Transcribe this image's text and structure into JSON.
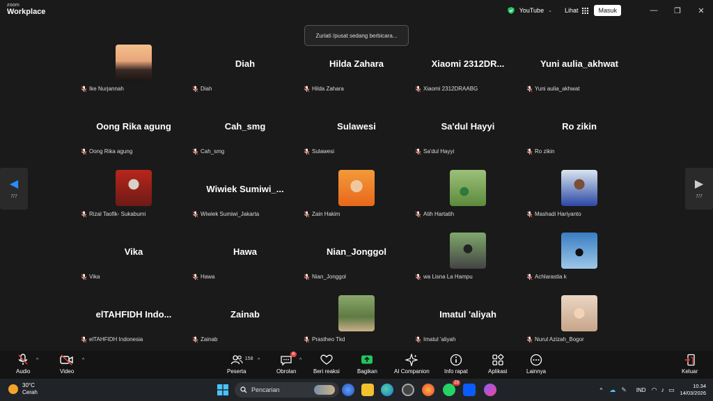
{
  "app": {
    "logo_top": "zoom",
    "logo_bottom": "Workplace"
  },
  "titlebar": {
    "youtube_label": "YouTube",
    "lihat": "Lihat",
    "masuk": "Masuk"
  },
  "toast": "Zuriati /pusat sedang berbicara...",
  "nav": {
    "page_left": "7/7",
    "page_right": "7/7"
  },
  "tiles": [
    {
      "bigname": "",
      "label": "Ike Nurjannah",
      "avatar": "sunset-silhouette"
    },
    {
      "bigname": "Diah",
      "label": "Diah"
    },
    {
      "bigname": "Hilda Zahara",
      "label": "Hilda Zahara"
    },
    {
      "bigname": "Xiaomi  2312DR...",
      "label": "Xiaomi 2312DRAABG"
    },
    {
      "bigname": "Yuni aulia_akhwat",
      "label": "Yuni aulia_akhwat"
    },
    {
      "bigname": "Oong Rika agung",
      "label": "Oong Rika agung"
    },
    {
      "bigname": "Cah_smg",
      "label": "Cah_smg"
    },
    {
      "bigname": "Sulawesi",
      "label": "Sulawesi"
    },
    {
      "bigname": "Sa'dul Hayyi",
      "label": "Sa'dul Hayyi"
    },
    {
      "bigname": "Ro zikin",
      "label": "Ro zikin"
    },
    {
      "bigname": "",
      "label": "Rizal Taofik- Sukabumi",
      "avatar": "red-outdoor"
    },
    {
      "bigname": "Wiwiek  Sumiwi_...",
      "label": "Wiwiek Sumiwi_Jakarta"
    },
    {
      "bigname": "",
      "label": "Zain Hakim",
      "avatar": "child-orange"
    },
    {
      "bigname": "",
      "label": "Atih Hartatih",
      "avatar": "green-field"
    },
    {
      "bigname": "",
      "label": "Mashadi Hariyanto",
      "avatar": "man-blue"
    },
    {
      "bigname": "Vika",
      "label": "Vika"
    },
    {
      "bigname": "Hawa",
      "label": "Hawa"
    },
    {
      "bigname": "Nian_Jonggol",
      "label": "Nian_Jonggol"
    },
    {
      "bigname": "",
      "label": "wa Lisna La Hampu",
      "avatar": "person-road"
    },
    {
      "bigname": "",
      "label": "Achlarastia k",
      "avatar": "person-stage"
    },
    {
      "bigname": "elTAHFIDH  Indo...",
      "label": "elTAHFIDH Indonesia"
    },
    {
      "bigname": "Zainab",
      "label": "Zainab"
    },
    {
      "bigname": "",
      "label": "Prastheo Tkd",
      "avatar": "group-field"
    },
    {
      "bigname": "Imatul 'aliyah",
      "label": "Imatul 'aliyah"
    },
    {
      "bigname": "",
      "label": "Nurul Azizah_Bogor",
      "avatar": "woman-hijab"
    }
  ],
  "toolbar": {
    "audio": "Audio",
    "video": "Video",
    "peserta": "Peserta",
    "peserta_count": "158",
    "obrolan": "Obrolan",
    "obrolan_badge": "6",
    "beri_reaksi": "Beri reaksi",
    "bagikan": "Bagikan",
    "ai_companion": "AI Companion",
    "info_rapat": "Info rapat",
    "aplikasi": "Aplikasi",
    "lainnya": "Lainnya",
    "keluar": "Keluar"
  },
  "taskbar": {
    "temp": "30°C",
    "weather": "Cerah",
    "search_placeholder": "Pencarian",
    "whatsapp_badge": "23",
    "lang": "IND",
    "time": "10.34",
    "date": "14/03/2026"
  },
  "colors": {
    "accent_blue": "#0b5cff",
    "muted_red": "#e0443e",
    "share_green": "#22c55e"
  }
}
